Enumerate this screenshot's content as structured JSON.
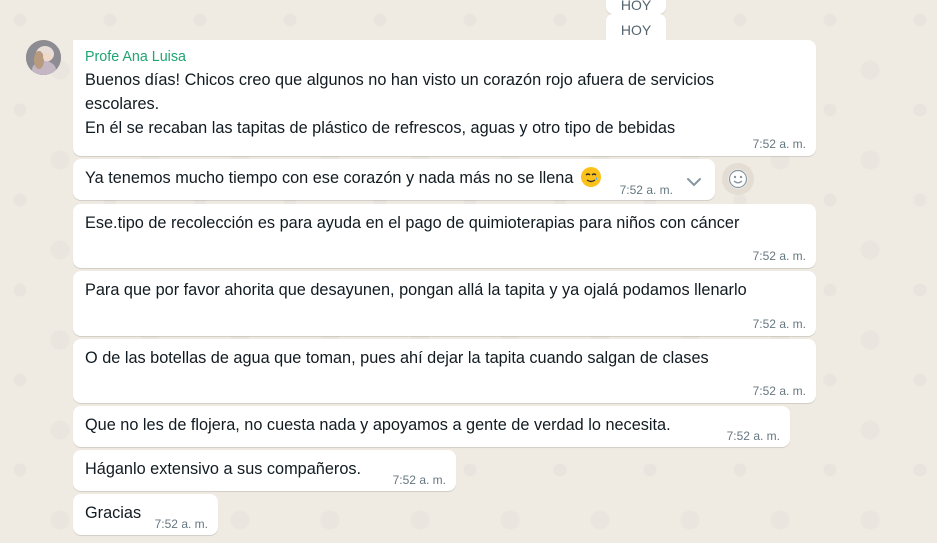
{
  "date_chip": "HOY",
  "date_chip_ghost": "HOY",
  "sender_name": "Profe Ana Luisa",
  "colors": {
    "sender": "#1fa472",
    "background": "#efeae2",
    "bubble": "#ffffff",
    "time": "#667781"
  },
  "messages": [
    {
      "lines": [
        "Buenos días! Chicos creo que algunos no han visto un corazón rojo afuera de servicios",
        "escolares.",
        "En él se recaban las tapitas de plástico de refrescos, aguas y otro tipo de bebidas"
      ],
      "time": "7:52 a. m."
    },
    {
      "text": "Ya tenemos mucho tiempo con ese corazón y nada más no se llena",
      "emoji": "smiling-face-with-tear",
      "time": "7:52 a. m."
    },
    {
      "text": "Ese.tipo de recolección es para ayuda en el pago de quimioterapias para niños con cáncer",
      "time": "7:52 a. m."
    },
    {
      "text": "Para que por favor ahorita que desayunen, pongan allá la tapita y ya ojalá podamos llenarlo",
      "time": "7:52 a. m."
    },
    {
      "text": "O de las botellas de agua que toman, pues ahí dejar la tapita cuando salgan de clases",
      "time": "7:52 a. m."
    },
    {
      "text": "Que no les de flojera, no cuesta nada y apoyamos a gente de verdad lo necesita.",
      "time": "7:52 a. m."
    },
    {
      "text": "Háganlo extensivo a sus compañeros.",
      "time": "7:52 a. m."
    },
    {
      "text": "Gracias",
      "time": "7:52 a. m."
    }
  ],
  "icons": {
    "menu": "chevron-down-icon",
    "react": "emoji-reaction-icon"
  }
}
